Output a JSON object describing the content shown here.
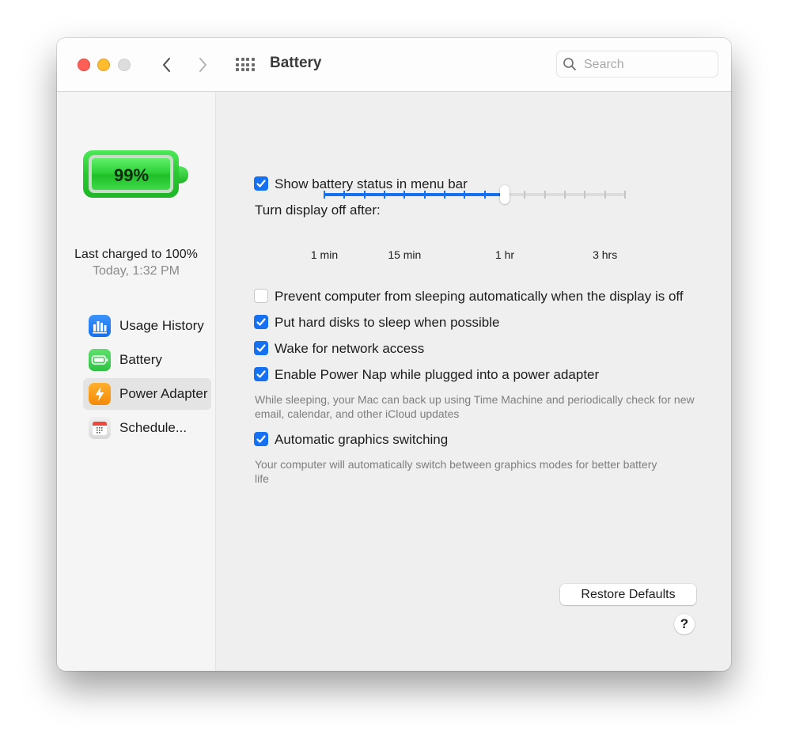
{
  "window": {
    "title": "Battery",
    "search": {
      "placeholder": "Search",
      "value": ""
    }
  },
  "sidebar": {
    "battery_level": "99%",
    "battery_fraction": 0.99,
    "last_charged": "Last charged to 100%",
    "last_charged_time": "Today, 1:32 PM",
    "items": [
      {
        "label": "Usage History",
        "icon": "usage-history-icon",
        "color": "#1b7cf5",
        "selected": false
      },
      {
        "label": "Battery",
        "icon": "battery-icon",
        "color": "#34c759",
        "selected": false
      },
      {
        "label": "Power Adapter",
        "icon": "power-adapter-icon",
        "color": "#f79a0e",
        "selected": true
      },
      {
        "label": "Schedule...",
        "icon": "schedule-icon",
        "color": "#e8e8e8",
        "selected": false
      }
    ]
  },
  "content": {
    "show_status": {
      "label": "Show battery status in menu bar",
      "checked": true
    },
    "display_off_label": "Turn display off after:",
    "slider": {
      "tick_count": 16,
      "value_index": 9,
      "value_label": "1 hr",
      "labels": [
        {
          "text": "1 min",
          "index": 0
        },
        {
          "text": "15 min",
          "index": 4
        },
        {
          "text": "1 hr",
          "index": 9
        },
        {
          "text": "3 hrs",
          "index": 14
        }
      ]
    },
    "options": [
      {
        "label": "Prevent computer from sleeping automatically when the display is off",
        "checked": false
      },
      {
        "label": "Put hard disks to sleep when possible",
        "checked": true
      },
      {
        "label": "Wake for network access",
        "checked": true
      },
      {
        "label": "Enable Power Nap while plugged into a power adapter",
        "checked": true
      }
    ],
    "power_nap_note": "While sleeping, your Mac can back up using Time Machine and periodically check for new email, calendar, and other iCloud updates",
    "graphics": {
      "label": "Automatic graphics switching",
      "checked": true
    },
    "graphics_note": "Your computer will automatically switch between graphics modes for better battery life",
    "restore_label": "Restore Defaults",
    "help_label": "?"
  },
  "colors": {
    "accent": "#1670f2",
    "battery_green": "#2fd13a"
  }
}
